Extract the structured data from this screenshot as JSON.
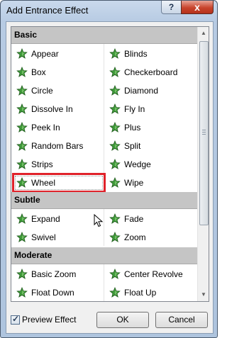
{
  "window": {
    "title": "Add Entrance Effect"
  },
  "titlebar": {
    "help": "?",
    "close": "x"
  },
  "colors": {
    "highlight": "#e0222a",
    "star": "#3f9a3a",
    "category_bg": "#c5c5c5"
  },
  "categories": {
    "basic": "Basic",
    "subtle": "Subtle",
    "moderate": "Moderate"
  },
  "basic_items": {
    "left": [
      "Appear",
      "Box",
      "Circle",
      "Dissolve In",
      "Peek In",
      "Random Bars",
      "Strips",
      "Wheel"
    ],
    "right": [
      "Blinds",
      "Checkerboard",
      "Diamond",
      "Fly In",
      "Plus",
      "Split",
      "Wedge",
      "Wipe"
    ]
  },
  "subtle_items": {
    "left": [
      "Expand",
      "Swivel"
    ],
    "right": [
      "Fade",
      "Zoom"
    ]
  },
  "moderate_items": {
    "left": [
      "Basic Zoom",
      "Float Down"
    ],
    "right": [
      "Center Revolve",
      "Float Up"
    ]
  },
  "icons": {
    "effect": "green-star-icon",
    "cursor": "arrow-cursor-icon"
  },
  "preview": {
    "label": "Preview Effect",
    "checked": true
  },
  "buttons": {
    "ok": "OK",
    "cancel": "Cancel"
  }
}
